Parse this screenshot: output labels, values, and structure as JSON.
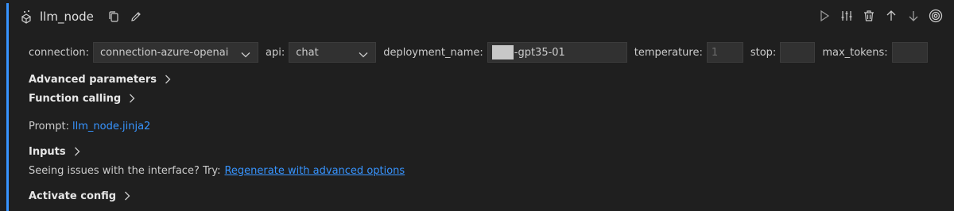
{
  "node": {
    "title": "llm_node"
  },
  "params": {
    "connection_label": "connection:",
    "connection_value": "connection-azure-openai",
    "api_label": "api:",
    "api_value": "chat",
    "deployment_label": "deployment_name:",
    "deployment_value_suffix": "-gpt35-01",
    "temperature_label": "temperature:",
    "temperature_placeholder": "1",
    "stop_label": "stop:",
    "stop_value": "",
    "max_tokens_label": "max_tokens:",
    "max_tokens_value": ""
  },
  "sections": {
    "advanced": "Advanced parameters",
    "function_calling": "Function calling",
    "inputs": "Inputs",
    "activate": "Activate config"
  },
  "prompt": {
    "label": "Prompt:",
    "file": "llm_node.jinja2"
  },
  "issues": {
    "text": "Seeing issues with the interface? Try:",
    "link": "Regenerate with advanced options"
  },
  "colors": {
    "accent": "#3794ff",
    "background": "#1f1f1f",
    "input_bg": "#313131"
  },
  "icons": {
    "node": "llm-node-icon",
    "toolbar": [
      "run-icon",
      "settings-sliders-icon",
      "trash-icon",
      "arrow-up-icon",
      "arrow-down-icon",
      "target-icon"
    ]
  }
}
